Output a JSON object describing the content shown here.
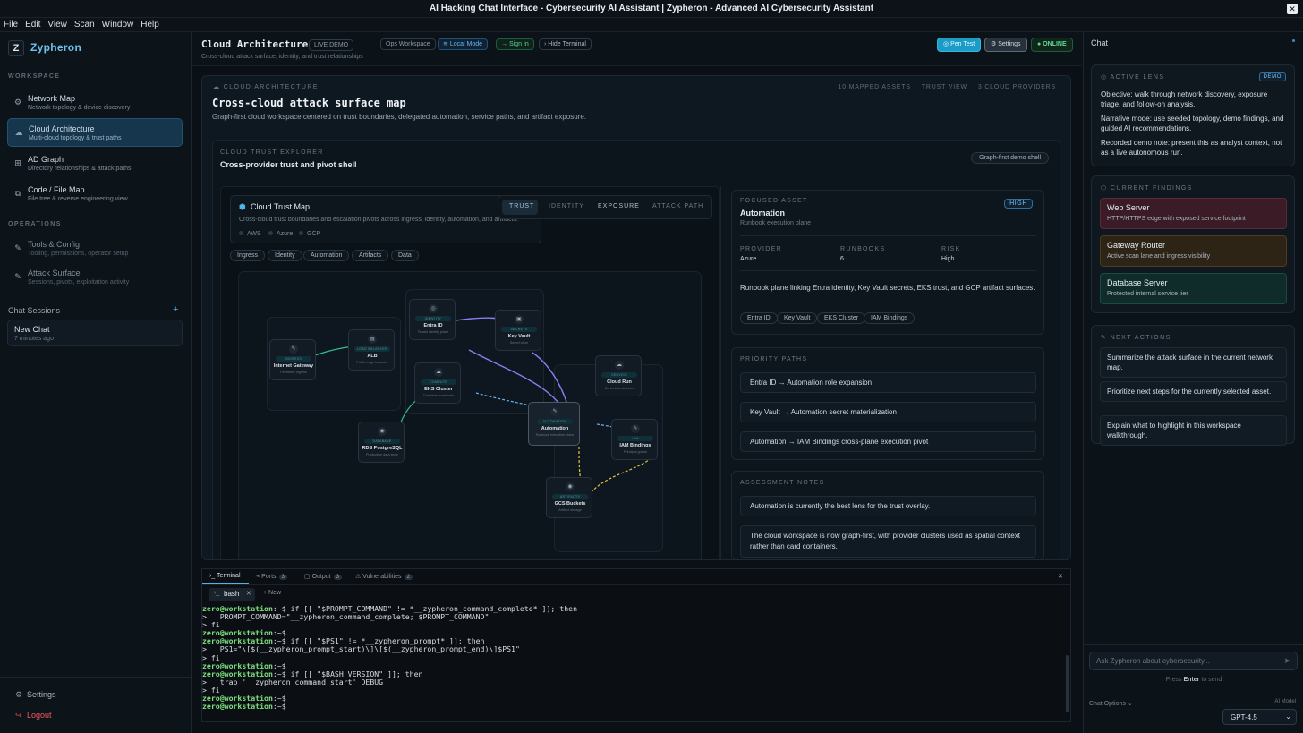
{
  "window": {
    "title": "AI Hacking Chat Interface - Cybersecurity AI Assistant | Zypheron - Advanced AI Cybersecurity Assistant",
    "close": "✕"
  },
  "menu": [
    "File",
    "Edit",
    "View",
    "Scan",
    "Window",
    "Help"
  ],
  "sidebar": {
    "logo": "Z",
    "brand": "Zypheron",
    "workspace_label": "WORKSPACE",
    "workspace_items": [
      {
        "label": "Network Map",
        "sub": "Network topology & device discovery",
        "icon": "⚙"
      },
      {
        "label": "Cloud Architecture",
        "sub": "Multi-cloud topology & trust paths",
        "icon": "☁"
      },
      {
        "label": "AD Graph",
        "sub": "Directory relationships & attack paths",
        "icon": "⊞"
      },
      {
        "label": "Code / File Map",
        "sub": "File tree & reverse engineering view",
        "icon": "⧉"
      }
    ],
    "operations_label": "OPERATIONS",
    "operations_items": [
      {
        "label": "Tools & Config",
        "sub": "Tooling, permissions, operator setup",
        "icon": "✎"
      },
      {
        "label": "Attack Surface",
        "sub": "Sessions, pivots, exploitation activity",
        "icon": "✎"
      }
    ],
    "chat_sessions_label": "Chat Sessions",
    "add": "+",
    "session": {
      "title": "New Chat",
      "time": "7 minutes ago"
    },
    "settings": "Settings",
    "logout": "Logout"
  },
  "header": {
    "title": "Cloud Architecture",
    "live": "LIVE DEMO",
    "ops": "Ops Workspace",
    "local": "Local Mode",
    "signin": "Sign In",
    "hide_terminal": "Hide Terminal",
    "subtitle": "Cross-cloud attack surface, identity, and trust relationships",
    "pentest": "Pen Test",
    "settings": "Settings",
    "online": "ONLINE"
  },
  "panel": {
    "kicker": "CLOUD ARCHITECTURE",
    "title": "Cross-cloud attack surface map",
    "desc": "Graph-first cloud workspace centered on trust boundaries, delegated automation, service paths, and artifact exposure.",
    "stats": [
      "10 MAPPED ASSETS",
      "TRUST VIEW",
      "3 CLOUD PROVIDERS"
    ],
    "explorer_kicker": "CLOUD TRUST EXPLORER",
    "explorer_title": "Cross-provider trust and pivot shell",
    "explorer_badge": "Graph-first demo shell",
    "map_title": "Cloud Trust Map",
    "map_desc": "Cross-cloud trust boundaries and escalation pivots across ingress, identity, automation, and artifacts.",
    "providers": [
      "AWS",
      "Azure",
      "GCP"
    ],
    "tabs": [
      "TRUST",
      "IDENTITY",
      "EXPOSURE",
      "ATTACK PATH"
    ],
    "chips": [
      "Ingress",
      "Identity",
      "Automation",
      "Artifacts",
      "Data"
    ],
    "nodes": [
      {
        "type": "INGRESS",
        "name": "Internet Gateway",
        "sub": "Perimeter ingress"
      },
      {
        "type": "LOAD BALANCER",
        "name": "ALB",
        "sub": "Public edge balancer"
      },
      {
        "type": "IDENTITY",
        "name": "Entra ID",
        "sub": "Tenant identity plane"
      },
      {
        "type": "SECRETS",
        "name": "Key Vault",
        "sub": "Secret store"
      },
      {
        "type": "COMPUTE",
        "name": "EKS Cluster",
        "sub": "Container workloads"
      },
      {
        "type": "SERVICE",
        "name": "Cloud Run",
        "sub": "Serverless services"
      },
      {
        "type": "AUTOMATION",
        "name": "Automation",
        "sub": "Runbook execution plane"
      },
      {
        "type": "IAM",
        "name": "IAM Bindings",
        "sub": "Principal grants"
      },
      {
        "type": "DATABASE",
        "name": "RDS PostgreSQL",
        "sub": "Production data store"
      },
      {
        "type": "ARTIFACTS",
        "name": "GCS Buckets",
        "sub": "Artifact storage"
      }
    ],
    "focus": {
      "kicker": "FOCUSED ASSET",
      "name": "Automation",
      "sub": "Runbook execution plane",
      "badge": "HIGH",
      "fields": [
        {
          "k": "PROVIDER",
          "v": "Azure"
        },
        {
          "k": "RUNBOOKS",
          "v": "6"
        },
        {
          "k": "RISK",
          "v": "High"
        }
      ],
      "desc": "Runbook plane linking Entra identity, Key Vault secrets, EKS trust, and GCP artifact surfaces.",
      "tags": [
        "Entra ID",
        "Key Vault",
        "EKS Cluster",
        "IAM Bindings"
      ]
    },
    "paths_kicker": "PRIORITY PATHS",
    "paths": [
      "Entra ID → Automation role expansion",
      "Key Vault → Automation secret materialization",
      "Automation → IAM Bindings cross-plane execution pivot"
    ],
    "notes_kicker": "ASSESSMENT NOTES",
    "notes": [
      "Automation is currently the best lens for the trust overlay.",
      "The cloud workspace is now graph-first, with provider clusters used as spatial context rather than card containers."
    ]
  },
  "terminal": {
    "tabs": [
      {
        "label": "Terminal",
        "count": ""
      },
      {
        "label": "Ports",
        "count": "3"
      },
      {
        "label": "Output",
        "count": "3"
      },
      {
        "label": "Vulnerabilities",
        "count": "2"
      }
    ],
    "shell": "bash",
    "new": "+ New",
    "close": "✕",
    "lines": [
      {
        "p": "zero@workstation",
        "r": ":~$ if [[ \"$PROMPT_COMMAND\" != *__zypheron_command_complete* ]]; then"
      },
      {
        "p": "",
        "r": ">   PROMPT_COMMAND=\"__zypheron_command_complete; $PROMPT_COMMAND\""
      },
      {
        "p": "",
        "r": "> fi"
      },
      {
        "p": "zero@workstation",
        "r": ":~$"
      },
      {
        "p": "zero@workstation",
        "r": ":~$ if [[ \"$PS1\" != *__zypheron_prompt* ]]; then"
      },
      {
        "p": "",
        "r": ">   PS1=\"\\[$(__zypheron_prompt_start)\\]\\[$(__zypheron_prompt_end)\\]$PS1\""
      },
      {
        "p": "",
        "r": "> fi"
      },
      {
        "p": "zero@workstation",
        "r": ":~$"
      },
      {
        "p": "zero@workstation",
        "r": ":~$ if [[ \"$BASH_VERSION\" ]]; then"
      },
      {
        "p": "",
        "r": ">   trap '__zypheron_command_start' DEBUG"
      },
      {
        "p": "",
        "r": "> fi"
      },
      {
        "p": "zero@workstation",
        "r": ":~$"
      },
      {
        "p": "zero@workstation",
        "r": ":~$"
      }
    ]
  },
  "chat": {
    "title": "Chat",
    "lens_kicker": "ACTIVE LENS",
    "demo": "DEMO",
    "lens_lines": [
      "Objective: walk through network discovery, exposure triage, and follow-on analysis.",
      "Narrative mode: use seeded topology, demo findings, and guided AI recommendations.",
      "Recorded demo note: present this as analyst context, not as a live autonomous run."
    ],
    "findings_kicker": "CURRENT FINDINGS",
    "findings": [
      {
        "title": "Web Server",
        "sub": "HTTP/HTTPS edge with exposed service footprint",
        "bg": "#3a1b26",
        "border": "#5b2a3a"
      },
      {
        "title": "Gateway Router",
        "sub": "Active scan lane and ingress visibility",
        "bg": "#2e2416",
        "border": "#4d3a20"
      },
      {
        "title": "Database Server",
        "sub": "Protected internal service tier",
        "bg": "#0f2c2a",
        "border": "#1b4a45"
      }
    ],
    "actions_kicker": "NEXT ACTIONS",
    "actions": [
      "Summarize the attack surface in the current network map.",
      "Prioritize next steps for the currently selected asset.",
      "Explain what to highlight in this workspace walkthrough."
    ],
    "placeholder": "Ask Zypheron about cybersecurity...",
    "send_hint_pre": "Press",
    "send_hint_key": "Enter",
    "send_hint_post": "to send",
    "options": "Chat Options",
    "model_label": "AI Model",
    "model": "GPT-4.5"
  }
}
